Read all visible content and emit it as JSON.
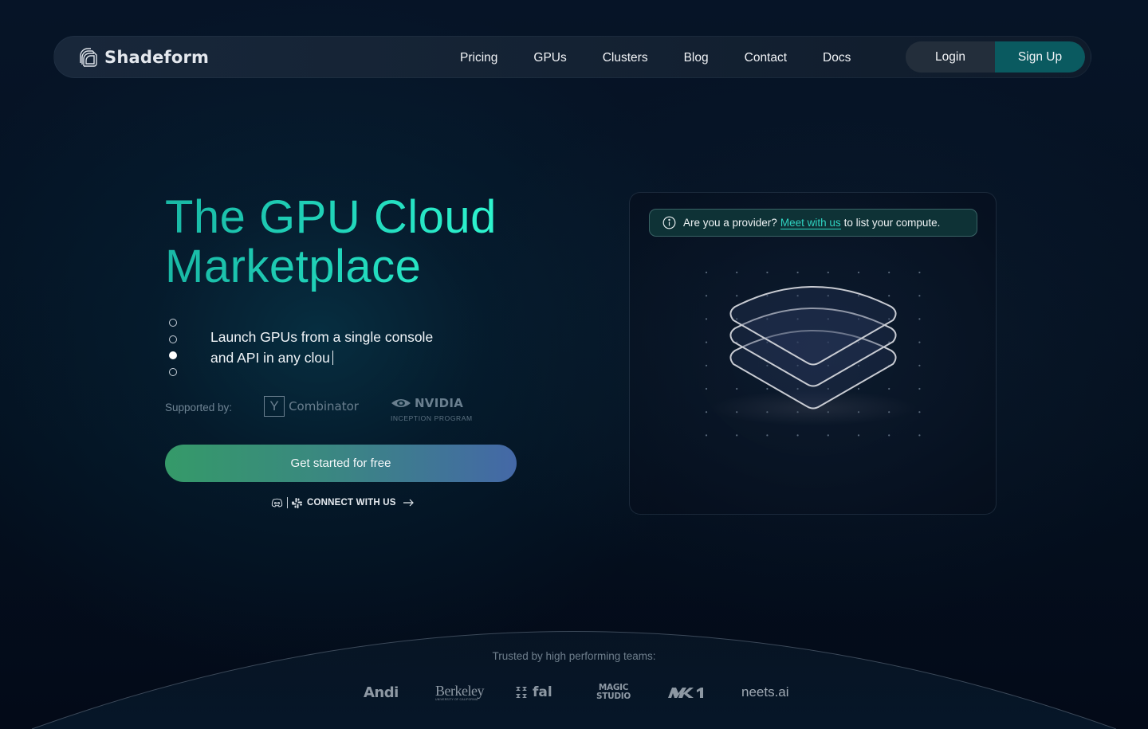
{
  "brand": {
    "name": "Shadeform",
    "logo_icon": "layered-squares-logo-icon"
  },
  "nav": {
    "links": [
      {
        "label": "Pricing"
      },
      {
        "label": "GPUs"
      },
      {
        "label": "Clusters"
      },
      {
        "label": "Blog"
      },
      {
        "label": "Contact"
      },
      {
        "label": "Docs"
      }
    ],
    "login_label": "Login",
    "signup_label": "Sign Up"
  },
  "hero": {
    "title_line1": "The GPU Cloud",
    "title_line2": "Marketplace",
    "subtitle_line1": "Launch GPUs from a single console",
    "subtitle_line2": "and API in any clou",
    "carousel": {
      "count": 4,
      "active_index": 2
    },
    "supported_label": "Supported by:",
    "supporters": {
      "yc_mark": "Y",
      "yc_text": "Combinator",
      "nvidia_text": "NVIDIA",
      "nvidia_sub": "INCEPTION PROGRAM"
    },
    "cta_label": "Get started for free",
    "connect_label": "CONNECT WITH US",
    "connect_icons": [
      "discord-icon",
      "slack-icon",
      "arrow-right-icon"
    ]
  },
  "panel": {
    "notice_before": "Are you a provider?",
    "notice_link": "Meet with us",
    "notice_after": "to list your compute.",
    "illustration": "stacked-layers-icon"
  },
  "trust": {
    "label": "Trusted by high performing teams:",
    "logos": [
      {
        "name": "Andi",
        "text": "Andi"
      },
      {
        "name": "Berkeley",
        "text": "Berkeley",
        "sub": "UNIVERSITY OF CALIFORNIA"
      },
      {
        "name": "fal",
        "text": "fal"
      },
      {
        "name": "Magic Studio",
        "text_line1": "MAGIC",
        "text_line2": "STUDIO"
      },
      {
        "name": "MK1",
        "text": "MK1"
      },
      {
        "name": "neets.ai",
        "text": "neets.ai"
      }
    ]
  },
  "colors": {
    "accent_teal": "#22d9bd",
    "signup_bg": "#0a5a60",
    "link": "#2fd3c1",
    "cta_start": "#359a69",
    "cta_end": "#4468a7",
    "page_bg": "#030a18"
  }
}
